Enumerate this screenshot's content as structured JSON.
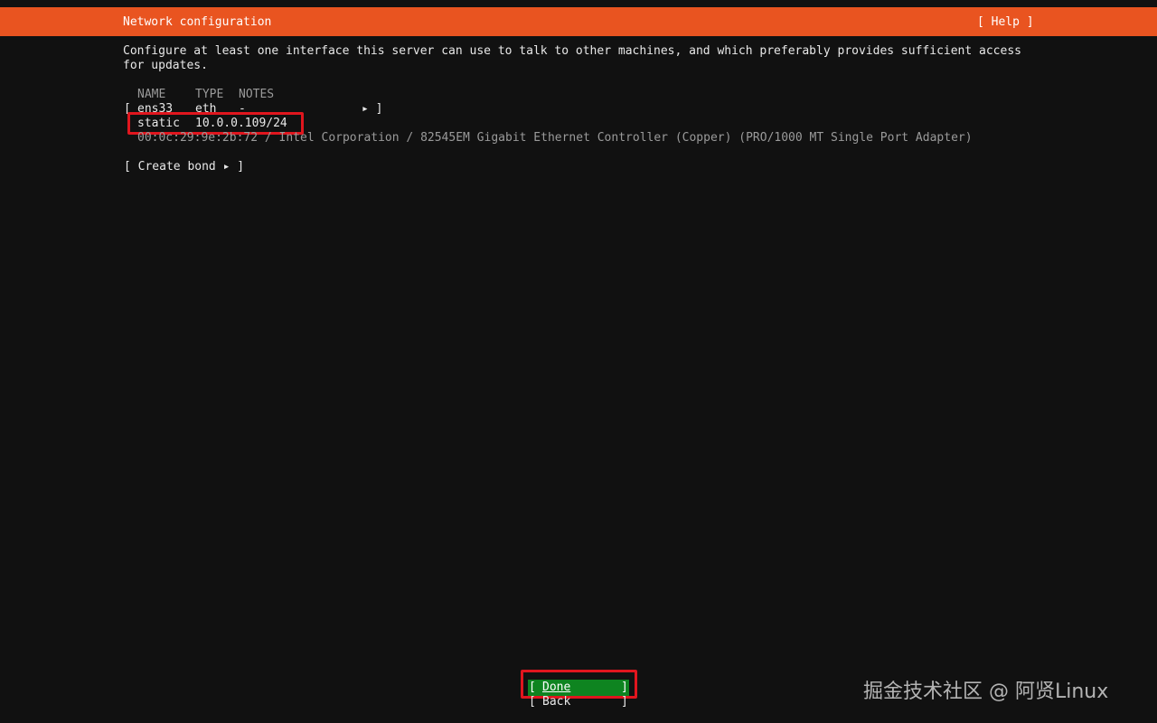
{
  "header": {
    "title": "Network configuration",
    "help": "[ Help ]"
  },
  "intro": "Configure at least one interface this server can use to talk to other machines, and which preferably provides sufficient access for updates.",
  "table": {
    "headers": {
      "name": "NAME",
      "type": "TYPE",
      "notes": "NOTES"
    },
    "interface": {
      "bracket_open": "[",
      "name": "ens33",
      "type": "eth",
      "notes": "-",
      "arrow": "▸ ]"
    },
    "address": {
      "method": "static",
      "ip": "10.0.0.109/24"
    },
    "hardware": "00:0c:29:9e:2b:72 / Intel Corporation / 82545EM Gigabit Ethernet Controller (Copper) (PRO/1000 MT Single Port Adapter)"
  },
  "create_bond": "[ Create bond ▸ ]",
  "buttons": {
    "done_open": "[ ",
    "done": "Done",
    "done_close": "]",
    "back_open": "[ ",
    "back": "Back",
    "back_close": "]"
  },
  "watermark": "掘金技术社区 @ 阿贤Linux",
  "colors": {
    "header_bg": "#e95420",
    "background": "#111111",
    "selected_button": "#0e8420",
    "highlight": "#e0161e"
  }
}
